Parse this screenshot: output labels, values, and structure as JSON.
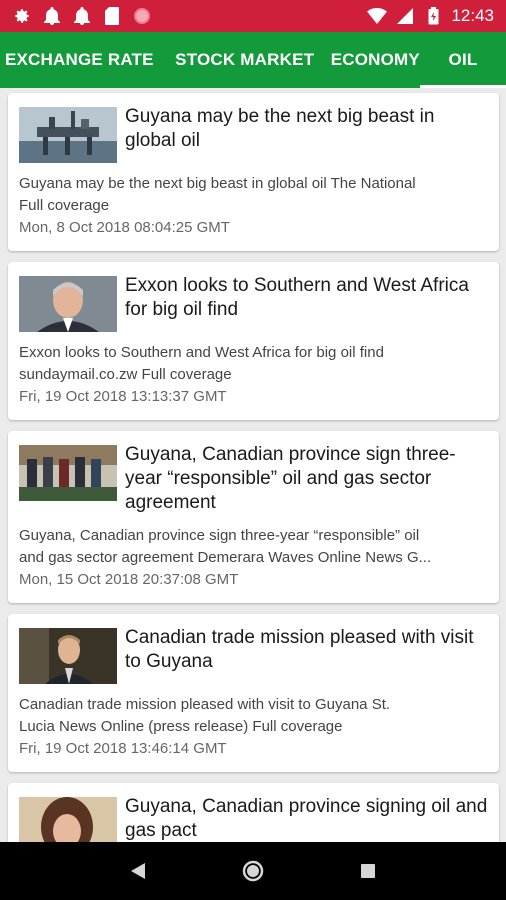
{
  "status_bar": {
    "time": "12:43",
    "icons": [
      "settings-icon",
      "bell-icon",
      "bell-icon",
      "sd-card-icon",
      "record-icon",
      "wifi-icon",
      "signal-icon",
      "battery-icon"
    ]
  },
  "tabs": [
    {
      "label": "EXCHANGE RATE",
      "active": false
    },
    {
      "label": "STOCK MARKET",
      "active": false
    },
    {
      "label": "ECONOMY",
      "active": false
    },
    {
      "label": "OIL",
      "active": true
    }
  ],
  "articles": [
    {
      "thumb": "oil-rig-image",
      "headline": "Guyana may be the next big beast in global oil",
      "summary_lines": [
        "Guyana may be the next big beast in global oil  The National",
        "Full coverage"
      ],
      "date": "Mon, 8 Oct 2018 08:04:25 GMT"
    },
    {
      "thumb": "man-portrait-image",
      "headline": "Exxon looks to Southern and West Africa for big oil find",
      "summary_lines": [
        "Exxon looks to Southern and West Africa for big oil find",
        "sundaymail.co.zw  Full coverage"
      ],
      "date": "Fri, 19 Oct 2018 13:13:37 GMT"
    },
    {
      "thumb": "group-signing-image",
      "headline": "Guyana, Canadian province sign three-year “responsible” oil and gas sector agreement",
      "summary_lines": [
        "Guyana, Canadian province sign three-year “responsible” oil",
        "and gas sector agreement  Demerara Waves Online News G..."
      ],
      "date": "Mon, 15 Oct 2018 20:37:08 GMT"
    },
    {
      "thumb": "speaker-image",
      "headline": "Canadian trade mission pleased with visit to Guyana",
      "summary_lines": [
        "Canadian trade mission pleased with visit to Guyana  St.",
        "Lucia News Online (press release)  Full coverage"
      ],
      "date": "Fri, 19 Oct 2018 13:46:14 GMT"
    },
    {
      "thumb": "woman-portrait-image",
      "headline": "Guyana, Canadian province signing oil and gas pact",
      "summary_lines": [],
      "date": ""
    }
  ],
  "nav": [
    "back-icon",
    "home-icon",
    "recents-icon"
  ],
  "colors": {
    "status_bar": "#d01f3b",
    "tab_bar": "#139a3a",
    "background": "#ebebeb"
  }
}
